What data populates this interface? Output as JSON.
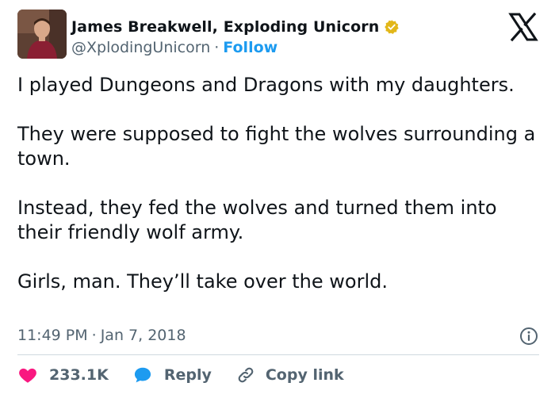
{
  "author": {
    "display_name": "James Breakwell, Exploding Unicorn",
    "handle": "@XplodingUnicorn",
    "follow_label": "Follow",
    "separator": "·"
  },
  "tweet": {
    "paragraphs": [
      "I played Dungeons and Dragons with my daughters.",
      "They were supposed to fight the wolves surrounding a town.",
      "Instead, they fed the wolves and turned them into their friendly wolf army.",
      "Girls, man. They’ll take over the world."
    ],
    "time": "11:49 PM",
    "date_separator": "·",
    "date": "Jan 7, 2018"
  },
  "actions": {
    "likes": "233.1K",
    "reply_label": "Reply",
    "copy_link_label": "Copy link"
  },
  "icons": {
    "brand": "x-logo-icon",
    "verified": "verified-badge-icon",
    "info": "info-icon",
    "like": "heart-icon",
    "reply": "speech-bubble-icon",
    "copy": "link-icon"
  },
  "colors": {
    "text": "#0f1419",
    "secondary": "#536471",
    "link": "#1d9bf0",
    "heart": "#f91880",
    "reply": "#1d9bf0",
    "verified": "#e2b719",
    "divider": "#cfd9de"
  }
}
